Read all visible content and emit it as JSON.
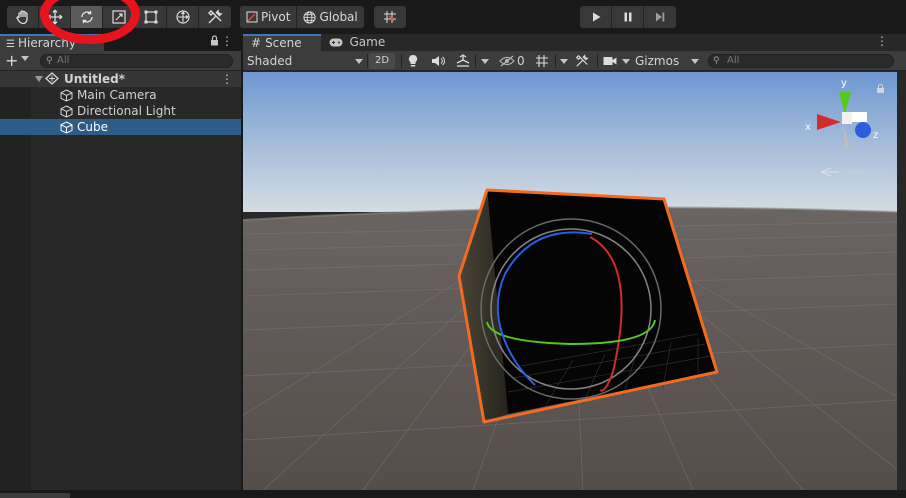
{
  "toolbar": {
    "tools": [
      {
        "name": "hand-tool",
        "active": false
      },
      {
        "name": "move-tool",
        "active": false
      },
      {
        "name": "rotate-tool",
        "active": true
      },
      {
        "name": "scale-tool",
        "active": false
      },
      {
        "name": "rect-tool",
        "active": false
      },
      {
        "name": "transform-tool",
        "active": false
      },
      {
        "name": "custom-tool",
        "active": false
      }
    ],
    "pivot_label": "Pivot",
    "global_label": "Global",
    "highlight_color": "#e8141c"
  },
  "hierarchy": {
    "tab_label": "Hierarchy",
    "search_placeholder": "All",
    "scene_name": "Untitled*",
    "items": [
      {
        "label": "Main Camera",
        "selected": false
      },
      {
        "label": "Directional Light",
        "selected": false
      },
      {
        "label": "Cube",
        "selected": true
      }
    ]
  },
  "scene": {
    "tabs": [
      {
        "label": "Scene",
        "active": true
      },
      {
        "label": "Game",
        "active": false
      }
    ],
    "shading_mode": "Shaded",
    "mode_2d": "2D",
    "hidden_count": "0",
    "gizmos_label": "Gizmos",
    "search_placeholder": "All",
    "axis_labels": {
      "x": "x",
      "y": "y",
      "z": "z"
    }
  },
  "colors": {
    "selection_blue": "#2c5d87",
    "tab_accent": "#3a79bb",
    "outline_orange": "#f26b21",
    "axis_x": "#d12b2b",
    "axis_y": "#55c81e",
    "axis_z": "#2d5ee0",
    "sky_top": "#6e97d3",
    "ground": "#5a5350"
  }
}
